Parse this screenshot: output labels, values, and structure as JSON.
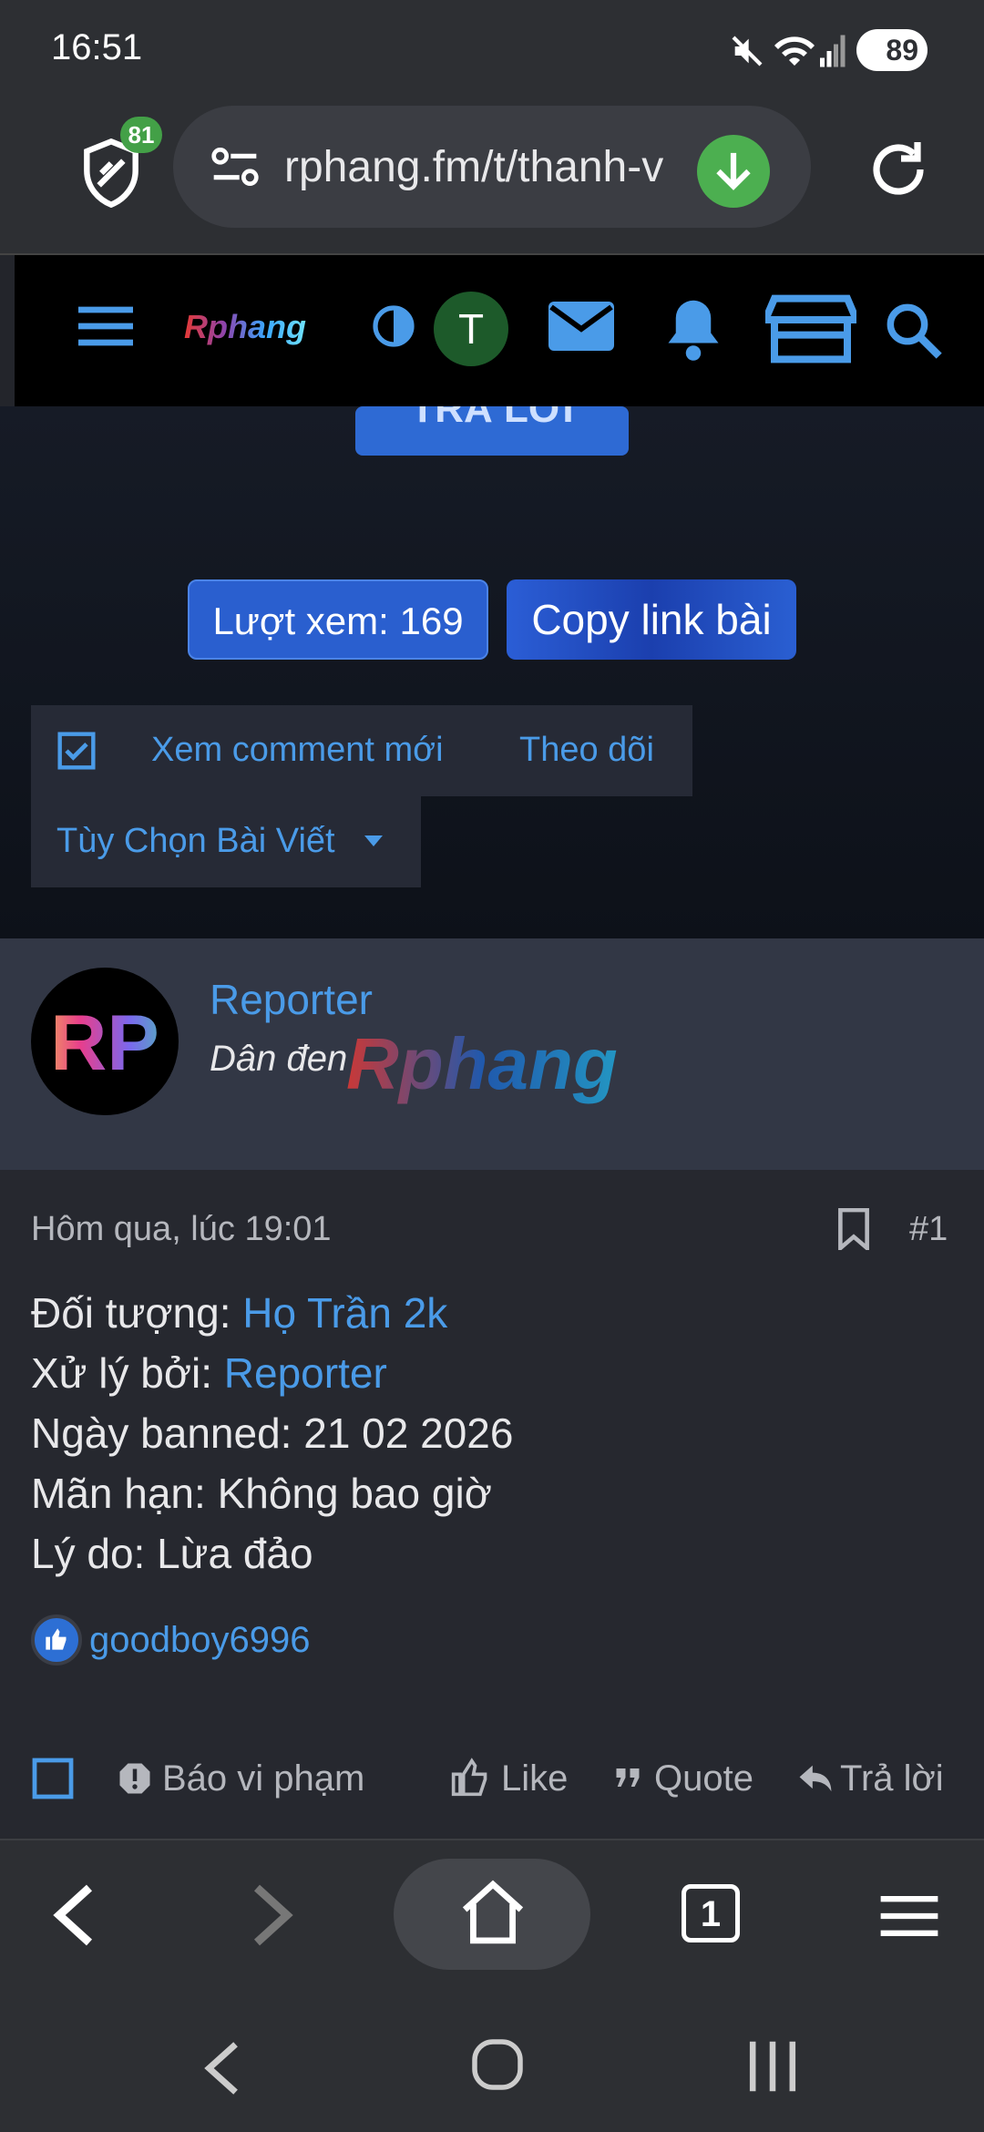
{
  "status_bar": {
    "time": "16:51",
    "battery": "89"
  },
  "browser": {
    "url": "rphang.fm/t/thanh-v",
    "shield_badge": "81",
    "tab_count": "1"
  },
  "site": {
    "logo": "Rphang",
    "user_initial": "T"
  },
  "thread": {
    "reply_button": "TRẢ LỜI",
    "views": "Lượt xem: 169",
    "copy_link": "Copy link bài",
    "new_comments": "Xem comment mới",
    "follow": "Theo dõi",
    "post_options": "Tùy Chọn Bài Viết"
  },
  "post": {
    "author": "Reporter",
    "author_title": "Dân đen",
    "avatar_text": "RP",
    "watermark": "Rphang",
    "timestamp": "Hôm qua, lúc 19:01",
    "number": "#1",
    "lines": [
      {
        "label": "Đối tượng: ",
        "value": "Họ Trần 2k",
        "link": true
      },
      {
        "label": "Xử lý bởi: ",
        "value": "Reporter",
        "link": true
      },
      {
        "label": "Ngày banned: ",
        "value": "21 02 2026",
        "link": false
      },
      {
        "label": "Mãn hạn: ",
        "value": "Không bao giờ",
        "link": false
      },
      {
        "label": "Lý do: ",
        "value": "Lừa đảo",
        "link": false
      }
    ],
    "reaction_user": "goodboy6996",
    "actions": {
      "report": "Báo vi phạm",
      "like": "Like",
      "quote": "Quote",
      "reply": "Trả lời"
    }
  },
  "colors": {
    "accent": "#4a9be8",
    "button_blue": "#2e6ad4",
    "success_green": "#4caf50"
  }
}
